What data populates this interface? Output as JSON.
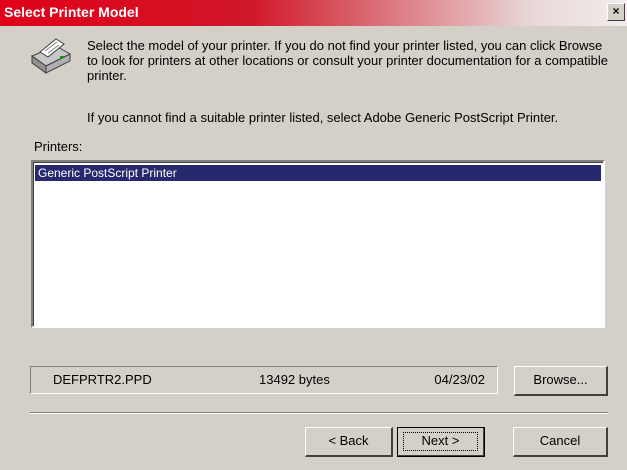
{
  "window": {
    "title": "Select Printer Model",
    "close_glyph": "×"
  },
  "intro": {
    "text": "Select the model of your printer. If you do not find your printer listed, you can click Browse to look for printers at other locations or consult your printer documentation for a compatible printer.",
    "hint": "If you cannot find a suitable printer listed, select Adobe Generic PostScript Printer."
  },
  "printers": {
    "label": "Printers:",
    "items": [
      "Generic PostScript Printer"
    ],
    "selected_index": 0
  },
  "file_info": {
    "filename": "DEFPRTR2.PPD",
    "size": "13492 bytes",
    "date": "04/23/02"
  },
  "buttons": {
    "browse": "Browse...",
    "back": "< Back",
    "next": "Next >",
    "cancel": "Cancel"
  },
  "icons": {
    "printer": "printer-icon",
    "close": "close-icon"
  },
  "colors": {
    "title_bar": "#d01828",
    "selection": "#28286e",
    "face": "#d4d0c8"
  }
}
